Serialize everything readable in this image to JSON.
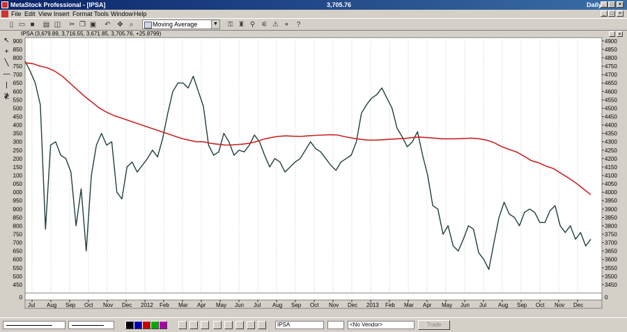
{
  "window": {
    "title": "MetaStock Professional - [IPSA]",
    "center_value": "3,705.76",
    "period": "Daily"
  },
  "menu": [
    "File",
    "Edit",
    "View",
    "Insert",
    "Format",
    "Tools",
    "Window",
    "Help"
  ],
  "toolbar": {
    "indicator_select": "Moving Average"
  },
  "chart_header": "IPSA (3,679.89, 3,716.55, 3,671.85, 3,705.76, +25.8799)",
  "volume_axis_label": "0",
  "status": {
    "symbol": "IPSA",
    "vendor": "<No Vendor>",
    "trade_label": "Trade"
  },
  "chart_data": {
    "type": "line",
    "title": "IPSA (3,679.89, 3,716.55, 3,671.85, 3,705.76, +25.8799)",
    "xlabel": "",
    "ylabel": "",
    "ylim": [
      3400,
      4950
    ],
    "yticks": [
      3450,
      3500,
      3550,
      3600,
      3650,
      3700,
      3750,
      3800,
      3850,
      3900,
      3950,
      4000,
      4050,
      4100,
      4150,
      4200,
      4250,
      4300,
      4350,
      4400,
      4450,
      4500,
      4550,
      4600,
      4650,
      4700,
      4750,
      4800,
      4850,
      4900
    ],
    "x_tick_labels": [
      "Jul",
      "Aug",
      "Sep",
      "Oct",
      "Nov",
      "Dec",
      "2012",
      "Feb",
      "Mar",
      "Apr",
      "May",
      "Jun",
      "Jul",
      "Aug",
      "Sep",
      "Oct",
      "Nov",
      "Dec",
      "2013",
      "Feb",
      "Mar",
      "Apr",
      "May",
      "Jun",
      "Jul",
      "Aug",
      "Sep",
      "Oct",
      "Nov",
      "Dec"
    ],
    "grid": "vertical dotted",
    "colors": {
      "price": "#1f3d3d",
      "moving_average": "#cc2222",
      "background": "#ffffff"
    },
    "series": [
      {
        "name": "",
        "values": [
          4780,
          4720,
          4650,
          4520,
          3780,
          4280,
          4300,
          4220,
          4200,
          4120,
          3800,
          4020,
          3650,
          4100,
          4280,
          4350,
          4280,
          4300,
          4000,
          3960,
          4150,
          4180,
          4120,
          4160,
          4200,
          4250,
          4210,
          4320,
          4470,
          4600,
          4650,
          4650,
          4620,
          4690,
          4600,
          4510,
          4280,
          4220,
          4240,
          4350,
          4300,
          4220,
          4250,
          4240,
          4280,
          4340,
          4300,
          4220,
          4150,
          4200,
          4180,
          4120,
          4150,
          4180,
          4200,
          4250,
          4300,
          4260,
          4240,
          4200,
          4160,
          4130,
          4180,
          4200,
          4220,
          4300,
          4470,
          4520,
          4560,
          4580,
          4620,
          4560,
          4500,
          4380,
          4330,
          4270,
          4300,
          4360,
          4220,
          4100,
          3920,
          3900,
          3750,
          3800,
          3680,
          3650,
          3720,
          3800,
          3780,
          3640,
          3600,
          3540,
          3700,
          3850,
          3940,
          3870,
          3850,
          3800,
          3880,
          3900,
          3880,
          3820,
          3820,
          3890,
          3920,
          3800,
          3760,
          3800,
          3720,
          3760,
          3680,
          3720
        ]
      },
      {
        "name": "",
        "values": [
          4770,
          4765,
          4750,
          4740,
          4720,
          4690,
          4650,
          4610,
          4570,
          4535,
          4500,
          4475,
          4455,
          4440,
          4425,
          4410,
          4395,
          4380,
          4365,
          4350,
          4335,
          4320,
          4310,
          4300,
          4300,
          4290,
          4285,
          4280,
          4282,
          4285,
          4290,
          4300,
          4315,
          4325,
          4332,
          4335,
          4333,
          4332,
          4335,
          4338,
          4340,
          4342,
          4340,
          4330,
          4322,
          4315,
          4310,
          4310,
          4312,
          4315,
          4318,
          4320,
          4325,
          4328,
          4325,
          4322,
          4318,
          4318,
          4318,
          4320,
          4322,
          4318,
          4310,
          4295,
          4272,
          4255,
          4240,
          4215,
          4188,
          4175,
          4155,
          4140,
          4112,
          4085,
          4055,
          4020,
          3985
        ]
      }
    ]
  }
}
